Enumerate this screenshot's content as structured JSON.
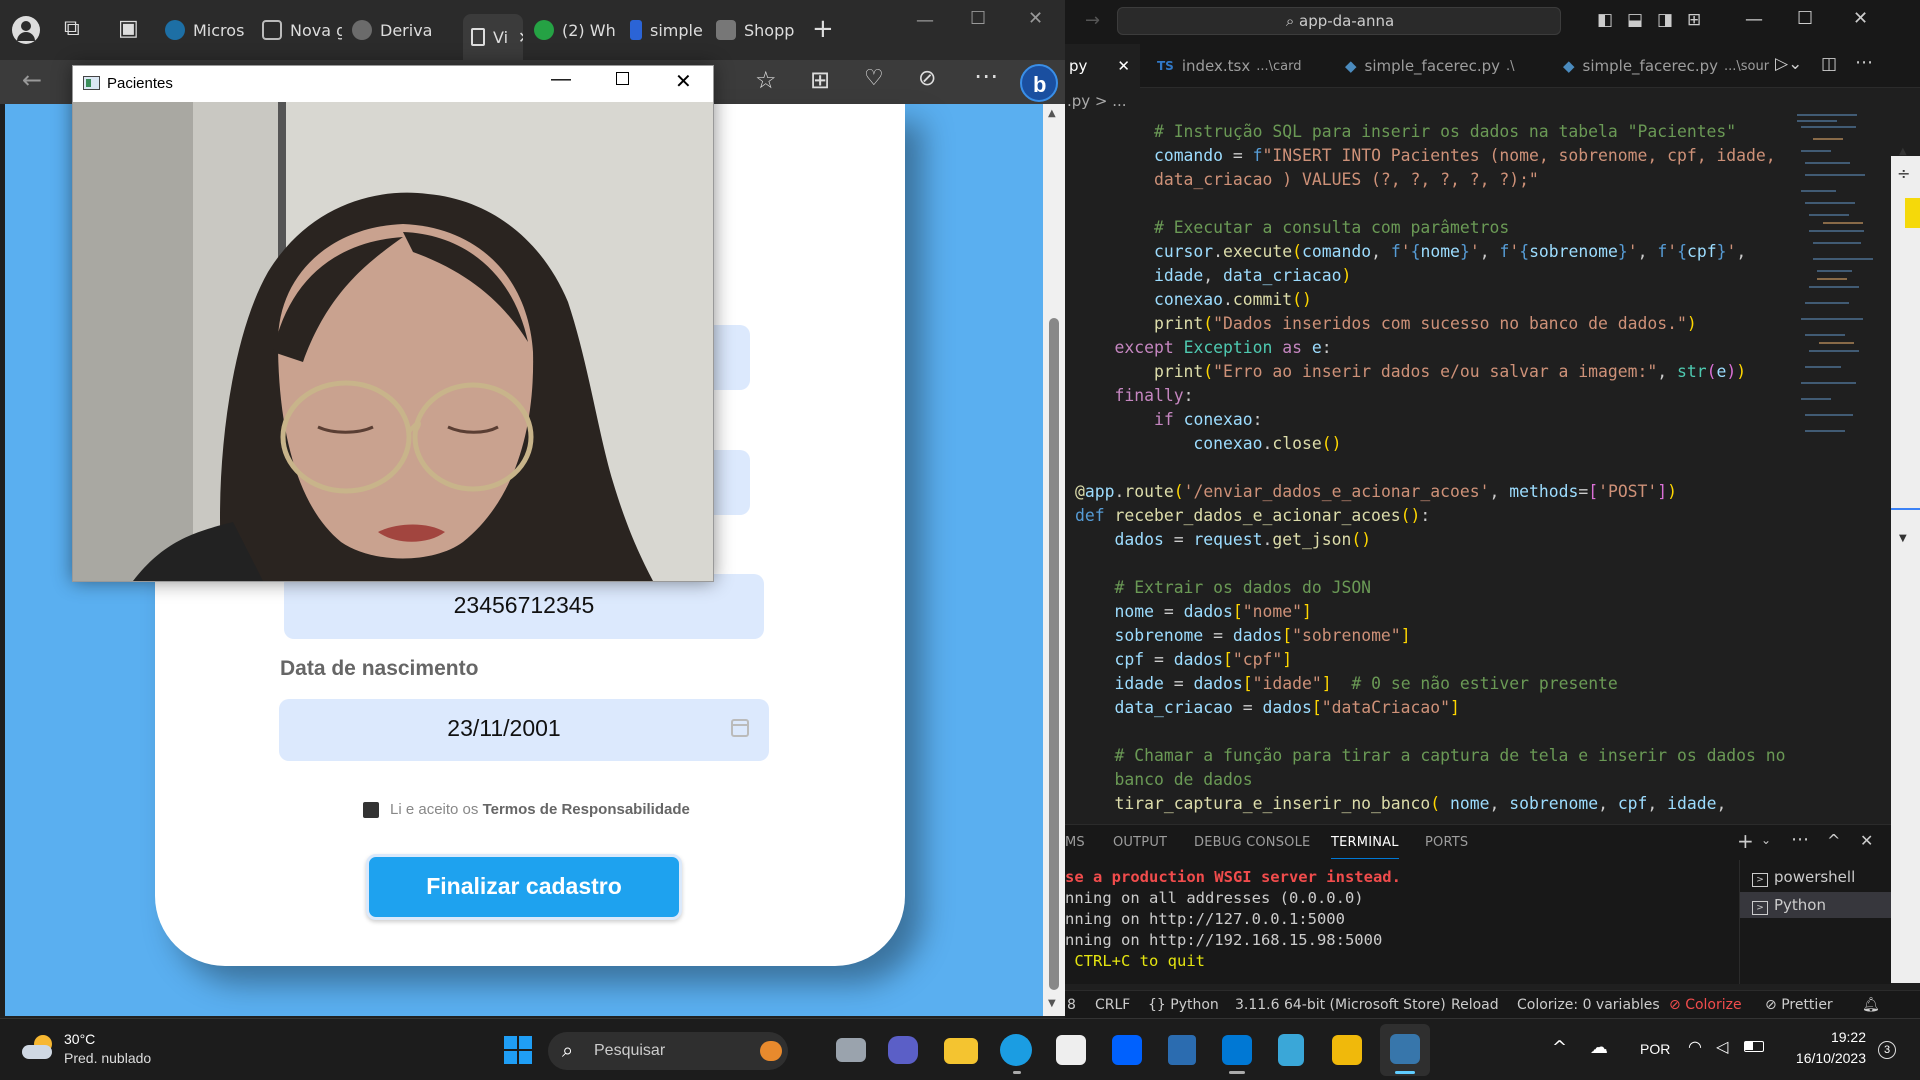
{
  "browser": {
    "tabs": [
      {
        "label": "Micros"
      },
      {
        "label": "Nova g"
      },
      {
        "label": "Deriva"
      },
      {
        "label": "Vi"
      },
      {
        "label": "(2) Wh"
      },
      {
        "label": "simple"
      },
      {
        "label": "Shopp"
      }
    ],
    "new_tab": "+"
  },
  "form": {
    "cpf_value": "23456712345",
    "birth_label": "Data de nascimento",
    "birth_value": "23/11/2001",
    "terms_prefix": "Li e aceito os ",
    "terms_link": "Termos de Responsabilidade",
    "submit_label": "Finalizar cadastro"
  },
  "pacientes_window": {
    "title": "Pacientes"
  },
  "vscode": {
    "search_text": "app-da-anna",
    "tabs": [
      {
        "label": "py"
      },
      {
        "label": "index.tsx",
        "hint": "...\\card",
        "badge": "TS"
      },
      {
        "label": "simple_facerec.py",
        "hint": ".\\"
      },
      {
        "label": "simple_facerec.py",
        "hint": "...\\sour"
      }
    ],
    "breadcrumb": ".py > ...",
    "panel_tabs": [
      "MS",
      "OUTPUT",
      "DEBUG CONSOLE",
      "TERMINAL",
      "PORTS"
    ],
    "terminal_lines": [
      "se a production WSGI server instead.",
      "nning on all addresses (0.0.0.0)",
      "nning on http://127.0.0.1:5000",
      "nning on http://192.168.15.98:5000",
      " CTRL+C to quit"
    ],
    "terminals": [
      "powershell",
      "Python"
    ],
    "status": {
      "lines": "8",
      "eol": "CRLF",
      "lang": "Python",
      "interpreter": "3.11.6 64-bit (Microsoft Store)",
      "reload": "Reload",
      "colorize_vars": "Colorize: 0 variables",
      "colorize": "Colorize",
      "prettier": "Prettier"
    }
  },
  "taskbar": {
    "temp": "30°C",
    "weather": "Pred. nublado",
    "search": "Pesquisar",
    "lang": "POR",
    "time": "19:22",
    "date": "16/10/2023",
    "notif": "3"
  }
}
